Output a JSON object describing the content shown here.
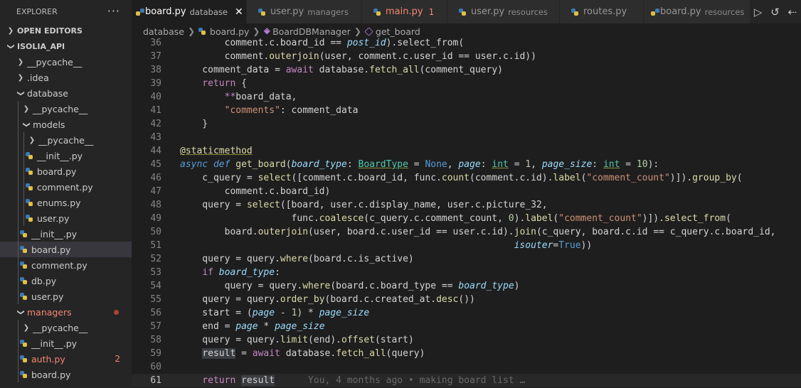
{
  "sidebar": {
    "title": "EXPLORER",
    "more": "···",
    "open_editors": "OPEN EDITORS",
    "project": "ISOLIA_API",
    "items": [
      {
        "label": "__pycache__"
      },
      {
        "label": ".idea"
      },
      {
        "label": "database"
      },
      {
        "label": "__pycache__"
      },
      {
        "label": "models"
      },
      {
        "label": "__pycache__"
      },
      {
        "label": "__init__.py"
      },
      {
        "label": "board.py"
      },
      {
        "label": "comment.py"
      },
      {
        "label": "enums.py"
      },
      {
        "label": "user.py"
      },
      {
        "label": "__init__.py"
      },
      {
        "label": "board.py"
      },
      {
        "label": "comment.py"
      },
      {
        "label": "db.py"
      },
      {
        "label": "user.py"
      },
      {
        "label": "managers"
      },
      {
        "label": "__pycache__"
      },
      {
        "label": "__init__.py"
      },
      {
        "label": "auth.py",
        "badge": "2"
      },
      {
        "label": "board.py"
      }
    ]
  },
  "tabs": [
    {
      "name": "board.py",
      "desc": "database",
      "close": "✕"
    },
    {
      "name": "user.py",
      "desc": "managers"
    },
    {
      "name": "main.py",
      "count": "1"
    },
    {
      "name": "user.py",
      "desc": "resources"
    },
    {
      "name": "routes.py"
    },
    {
      "name": "board.py",
      "desc": "resources"
    }
  ],
  "breadcrumb": [
    "database",
    "board.py",
    "BoardDBManager",
    "get_board"
  ],
  "blame": "You, 4 months ago • making board list …",
  "line_numbers": [
    "36",
    "37",
    "38",
    "39",
    "40",
    "41",
    "42",
    "43",
    "44",
    "45",
    "46",
    "47",
    "48",
    "49",
    "50",
    "51",
    "52",
    "53",
    "54",
    "55",
    "56",
    "57",
    "58",
    "59",
    "60",
    "61"
  ]
}
